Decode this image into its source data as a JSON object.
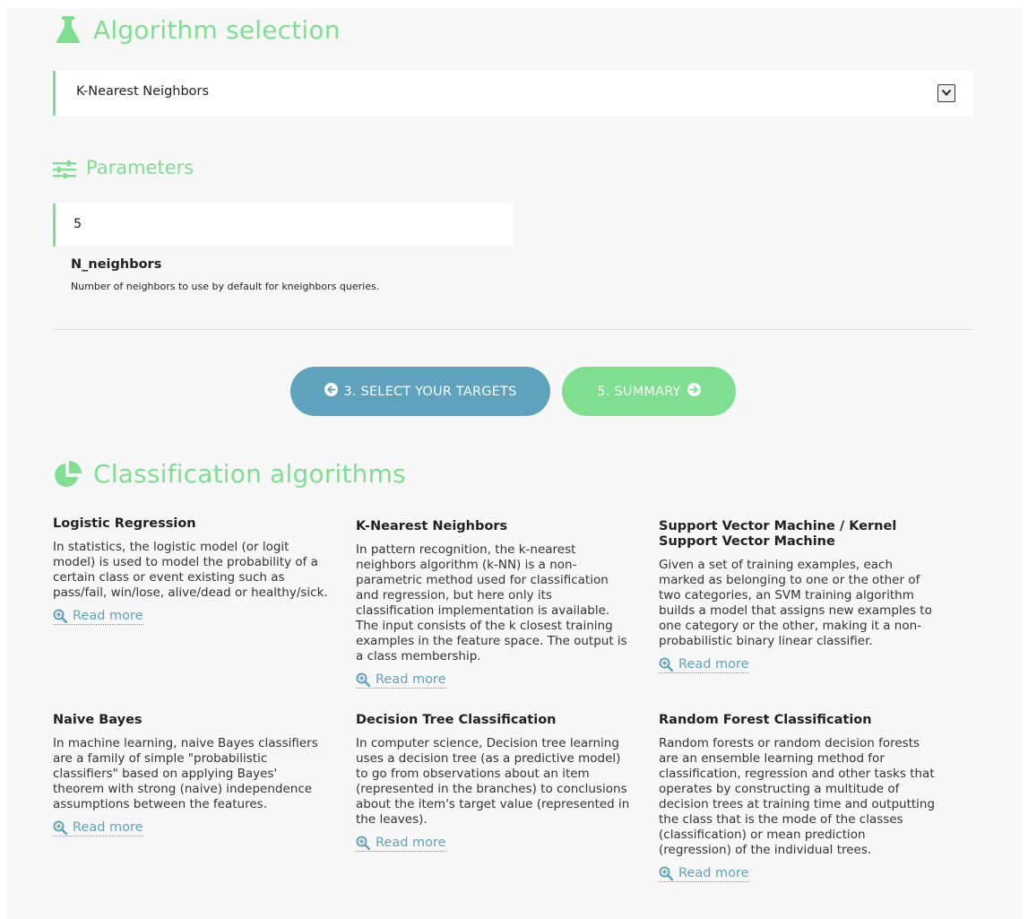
{
  "algorithm_section": {
    "title": "Algorithm selection",
    "selected": "K-Nearest Neighbors"
  },
  "parameters_section": {
    "title": "Parameters",
    "params": [
      {
        "value": "5",
        "name": "N_neighbors",
        "description": "Number of neighbors to use by default for kneighbors queries."
      }
    ]
  },
  "navigation": {
    "back_label": "3. SELECT YOUR TARGETS",
    "next_label": "5. SUMMARY"
  },
  "classification_section": {
    "title": "Classification algorithms",
    "read_more_label": "Read more",
    "algorithms": [
      {
        "title": "Logistic Regression",
        "description": "In statistics, the logistic model (or logit model) is used to model the probability of a certain class or event existing such as pass/fail, win/lose, alive/dead or healthy/sick."
      },
      {
        "title": "K-Nearest Neighbors",
        "description": "In pattern recognition, the k-nearest neighbors algorithm (k-NN) is a non-parametric method used for classification and regression, but here only its classification implementation is available. The input consists of the k closest training examples in the feature space. The output is a class membership."
      },
      {
        "title": "Support Vector Machine / Kernel Support Vector Machine",
        "description": "Given a set of training examples, each marked as belonging to one or the other of two categories, an SVM training algorithm builds a model that assigns new examples to one category or the other, making it a non-probabilistic binary linear classifier."
      },
      {
        "title": "Naive Bayes",
        "description": "In machine learning, naive Bayes classifiers are a family of simple \"probabilistic classifiers\" based on applying Bayes' theorem with strong (naive) independence assumptions between the features."
      },
      {
        "title": "Decision Tree Classification",
        "description": "In computer science, Decision tree learning uses a decision tree (as a predictive model) to go from observations about an item (represented in the branches) to conclusions about the item's target value (represented in the leaves)."
      },
      {
        "title": "Random Forest Classification",
        "description": "Random forests or random decision forests are an ensemble learning method for classification, regression and other tasks that operates by constructing a multitude of decision trees at training time and outputting the class that is the mode of the classes (classification) or mean prediction (regression) of the individual trees."
      }
    ]
  },
  "colors": {
    "accent_green": "#7ddf8f",
    "accent_blue": "#5fa2bd",
    "panel_bg": "#f7f7f7"
  }
}
